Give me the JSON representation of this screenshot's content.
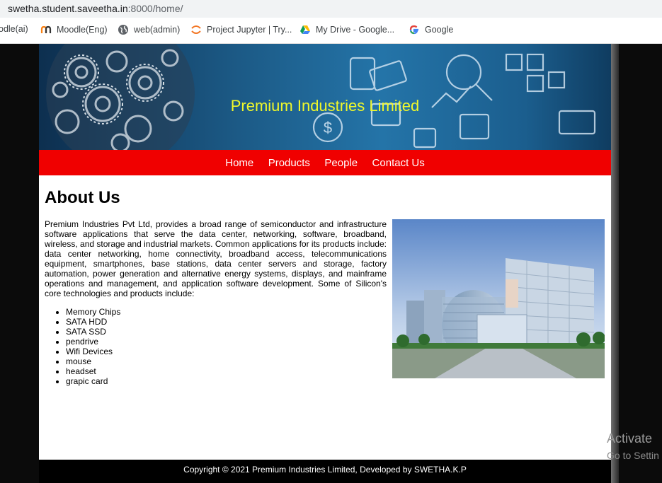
{
  "browser": {
    "url_host": "swetha.student.saveetha.in",
    "url_path": ":8000/home/",
    "bookmarks": [
      {
        "label": "odle(ai)",
        "icon": "bookmark-partial"
      },
      {
        "label": "Moodle(Eng)",
        "icon": "moodle-icon"
      },
      {
        "label": "web(admin)",
        "icon": "globe-icon"
      },
      {
        "label": "Project Jupyter | Try...",
        "icon": "jupyter-icon"
      },
      {
        "label": "My Drive - Google...",
        "icon": "drive-icon"
      },
      {
        "label": "Google",
        "icon": "google-icon"
      }
    ]
  },
  "site": {
    "title": "Premium Industries Limited",
    "nav": [
      "Home",
      "Products",
      "People",
      "Contact Us"
    ],
    "about_heading": "About Us",
    "about_text": "Premium Industries Pvt Ltd, provides a broad range of semiconductor and infrastructure software applications that serve the data center, networking, software, broadband, wireless, and storage and industrial markets. Common applications for its products include: data center networking, home connectivity, broadband access, telecommunications equipment, smartphones, base stations, data center servers and storage, factory automation, power generation and alternative energy systems, displays, and mainframe operations and management, and application software development. Some of Silicon's core technologies and products include:",
    "products": [
      "Memory Chips",
      "SATA HDD",
      "SATA SSD",
      "pendrive",
      "Wifi Devices",
      "mouse",
      "headset",
      "grapic card"
    ],
    "footer": "Copyright © 2021 Premium Industries Limited, Developed by SWETHA.K.P"
  },
  "os_overlay": {
    "line1": "Activate",
    "line2": "Go to Settin"
  },
  "colors": {
    "nav_bg": "#f00000",
    "title_color": "#f0f82a",
    "footer_bg": "#000000"
  }
}
